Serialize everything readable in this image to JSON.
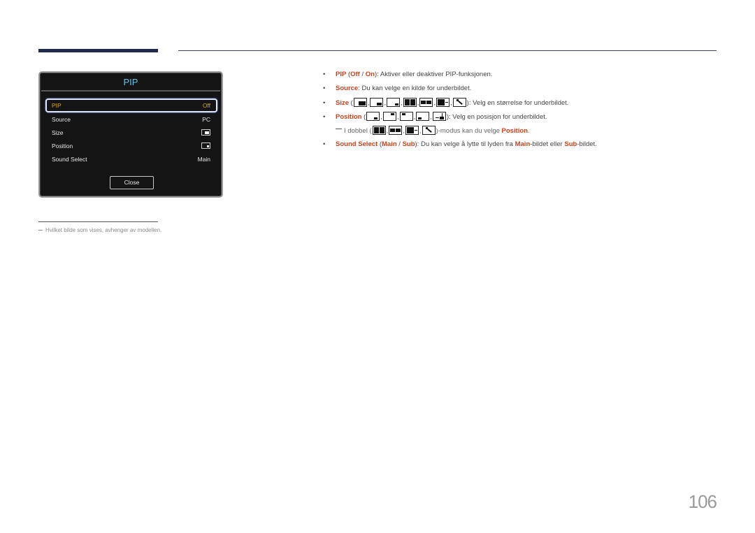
{
  "header": {
    "accent_color": "#1f2a4d"
  },
  "osd": {
    "title": "PIP",
    "title_color": "#5ec3ea",
    "highlight_color": "#e0a800",
    "rows": [
      {
        "label": "PIP",
        "value": "Off",
        "selected": true
      },
      {
        "label": "Source",
        "value": "PC"
      },
      {
        "label": "Size",
        "value_icon": "pip-size-small-icon"
      },
      {
        "label": "Position",
        "value_icon": "pip-position-bottom-right-icon"
      },
      {
        "label": "Sound Select",
        "value": "Main"
      }
    ],
    "close_label": "Close"
  },
  "content": {
    "keyword_color": "#c8421a",
    "bullet": "•",
    "pip_line": {
      "kw": "PIP",
      "open": " (",
      "off": "Off",
      "sep": " / ",
      "on": "On",
      "close": "): Aktiver eller deaktiver PIP-funksjonen."
    },
    "source_line": {
      "kw": "Source",
      "text": ": Du kan velge en kilde for underbildet."
    },
    "size_line": {
      "kw": "Size",
      "open": " (",
      "icons": [
        "pip-size-large-icon",
        "pip-size-medium-icon",
        "pip-size-small-icon",
        "pip-split-full-icon",
        "pip-split-wide-icon",
        "pip-pbp-icon",
        "pip-diagonal-icon"
      ],
      "text": "): Velg en størrelse for underbildet."
    },
    "position_line": {
      "kw": "Position",
      "open": " (",
      "icons": [
        "position-bottom-right-icon",
        "position-top-right-icon",
        "position-top-left-icon",
        "position-bottom-left-icon",
        "position-custom-icon"
      ],
      "text": "): Velg en posisjon for underbildet."
    },
    "note_line": {
      "prefix": "I dobbel (",
      "icons": [
        "pip-split-full-icon",
        "pip-split-wide-icon",
        "pip-pbp-icon",
        "pip-diagonal-icon"
      ],
      "middle": ")-modus kan du velge ",
      "kw": "Position",
      "end": "."
    },
    "sound_line": {
      "kw": "Sound Select",
      "open": " (",
      "main": "Main",
      "sep": " / ",
      "sub": "Sub",
      "text1": "): Du kan velge å lytte til lyden fra ",
      "main2": "Main",
      "text2": "-bildet eller ",
      "sub2": "Sub",
      "text3": "-bildet."
    }
  },
  "footnote": {
    "text": "Hvilket bilde som vises, avhenger av modellen."
  },
  "page_number": "106"
}
